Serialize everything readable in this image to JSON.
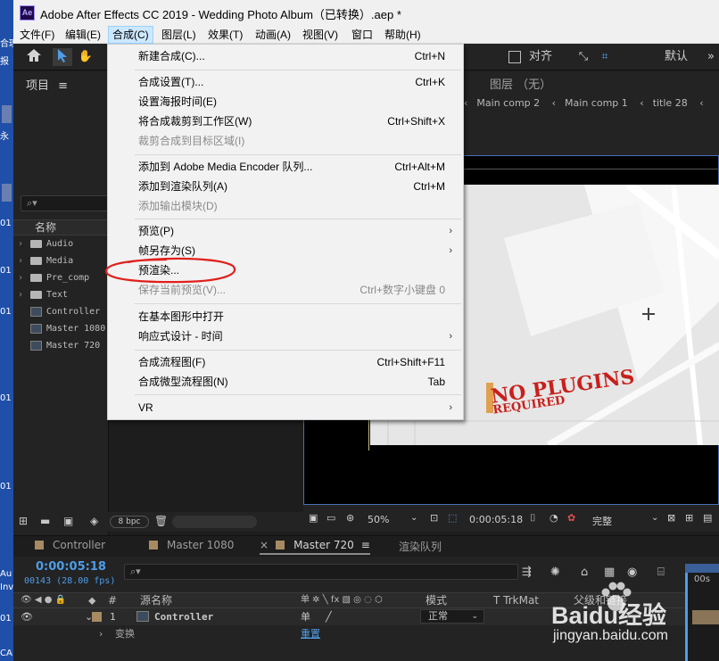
{
  "window": {
    "title": "Adobe After Effects CC 2019 - Wedding Photo Album（已转换）.aep *",
    "app_badge": "Ae"
  },
  "desktop_labels": [
    "合理",
    "报",
    "永",
    "01",
    "01",
    "01",
    "01",
    "01",
    "Au",
    "Inve",
    "01",
    "CA"
  ],
  "menubar": [
    "文件(F)",
    "编辑(E)",
    "合成(C)",
    "图层(L)",
    "效果(T)",
    "动画(A)",
    "视图(V)",
    "窗口",
    "帮助(H)"
  ],
  "toolbar": {
    "align_label": "对齐",
    "workspace_label": "默认"
  },
  "project": {
    "title": "项目",
    "column_name": "名称",
    "bpc": "8 bpc",
    "items": [
      {
        "name": "Audio",
        "type": "folder"
      },
      {
        "name": "Media",
        "type": "folder"
      },
      {
        "name": "Pre_comp",
        "type": "folder"
      },
      {
        "name": "Text",
        "type": "folder"
      },
      {
        "name": "Controller",
        "type": "comp"
      },
      {
        "name": "Master 1080",
        "type": "comp"
      },
      {
        "name": "Master  720",
        "type": "comp"
      }
    ]
  },
  "viewer": {
    "layer_label": "图层 （无）",
    "breadcrumbs": [
      "Main comp 2",
      "Main comp 1",
      "title 28"
    ],
    "headline": "NO PLUGINS",
    "subline": "REQUIRED",
    "zoom": "50%",
    "timecode": "0:00:05:18",
    "resolution": "完整"
  },
  "dropdown_menu": {
    "items": [
      {
        "label": "新建合成(C)...",
        "shortcut": "Ctrl+N",
        "disabled": false,
        "submenu": false
      },
      {
        "label": "合成设置(T)...",
        "shortcut": "Ctrl+K",
        "disabled": false,
        "submenu": false
      },
      {
        "label": "设置海报时间(E)",
        "shortcut": "",
        "disabled": false,
        "submenu": false
      },
      {
        "label": "将合成裁剪到工作区(W)",
        "shortcut": "Ctrl+Shift+X",
        "disabled": false,
        "submenu": false
      },
      {
        "label": "裁剪合成到目标区域(I)",
        "shortcut": "",
        "disabled": true,
        "submenu": false
      },
      {
        "label": "添加到 Adobe Media Encoder 队列...",
        "shortcut": "Ctrl+Alt+M",
        "disabled": false,
        "submenu": false
      },
      {
        "label": "添加到渲染队列(A)",
        "shortcut": "Ctrl+M",
        "disabled": false,
        "submenu": false
      },
      {
        "label": "添加输出模块(D)",
        "shortcut": "",
        "disabled": true,
        "submenu": false
      },
      {
        "label": "预览(P)",
        "shortcut": "",
        "disabled": false,
        "submenu": true
      },
      {
        "label": "帧另存为(S)",
        "shortcut": "",
        "disabled": false,
        "submenu": true
      },
      {
        "label": "预渲染...",
        "shortcut": "",
        "disabled": false,
        "submenu": false,
        "highlighted": true
      },
      {
        "label": "保存当前预览(V)...",
        "shortcut": "Ctrl+数字小键盘 0",
        "disabled": true,
        "submenu": false
      },
      {
        "label": "在基本图形中打开",
        "shortcut": "",
        "disabled": false,
        "submenu": false
      },
      {
        "label": "响应式设计 - 时间",
        "shortcut": "",
        "disabled": false,
        "submenu": true
      },
      {
        "label": "合成流程图(F)",
        "shortcut": "Ctrl+Shift+F11",
        "disabled": false,
        "submenu": false
      },
      {
        "label": "合成微型流程图(N)",
        "shortcut": "Tab",
        "disabled": false,
        "submenu": false
      },
      {
        "label": "VR",
        "shortcut": "",
        "disabled": false,
        "submenu": true
      }
    ]
  },
  "timeline_tabs": [
    "Controller",
    "Master 1080",
    "Master 720",
    "渲染队列"
  ],
  "timeline": {
    "timecode": "0:00:05:18",
    "frames": "00143 (28.00 fps)",
    "col_source": "源名称",
    "col_mode": "模式",
    "col_trkmat": "T  TrkMat",
    "col_parent": "父级和链接",
    "layer_index": "1",
    "layer_name": "Controller",
    "layer_mode": "正常",
    "transform_label": "变换",
    "reset_label": "重置",
    "ruler_label": "00s"
  },
  "watermark": {
    "brand": "Baidu经验",
    "url": "jingyan.baidu.com"
  },
  "colors": {
    "accent_blue": "#4e9de8",
    "menu_active": "#cce8ff",
    "annotation_red": "#e0201c",
    "headline_red": "#c8201c"
  }
}
